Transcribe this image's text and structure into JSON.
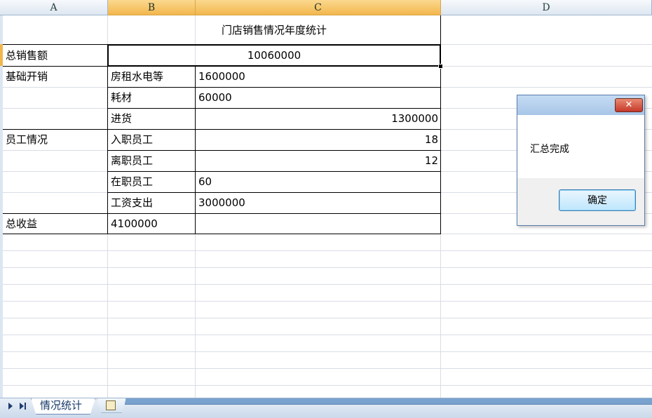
{
  "columns": [
    "A",
    "B",
    "C",
    "D"
  ],
  "sheet": {
    "title": "门店销售情况年度统计",
    "total_sales_label": "总销售额",
    "total_sales_value": "10060000",
    "base_cost_label": "基础开销",
    "rent_label": "房租水电等",
    "rent_value": "1600000",
    "materials_label": "耗材",
    "materials_value": "60000",
    "purchase_label": "进货",
    "purchase_value": "1300000",
    "staff_label": "员工情况",
    "hired_label": "入职员工",
    "hired_value": "18",
    "left_label": "离职员工",
    "left_value": "12",
    "current_label": "在职员工",
    "current_value": "60",
    "salary_label": "工资支出",
    "salary_value": "3000000",
    "profit_label": "总收益",
    "profit_value": "4100000"
  },
  "tabs": {
    "active": "情况统计"
  },
  "dialog": {
    "close_symbol": "✕",
    "message": "汇总完成",
    "ok_label": "确定"
  }
}
